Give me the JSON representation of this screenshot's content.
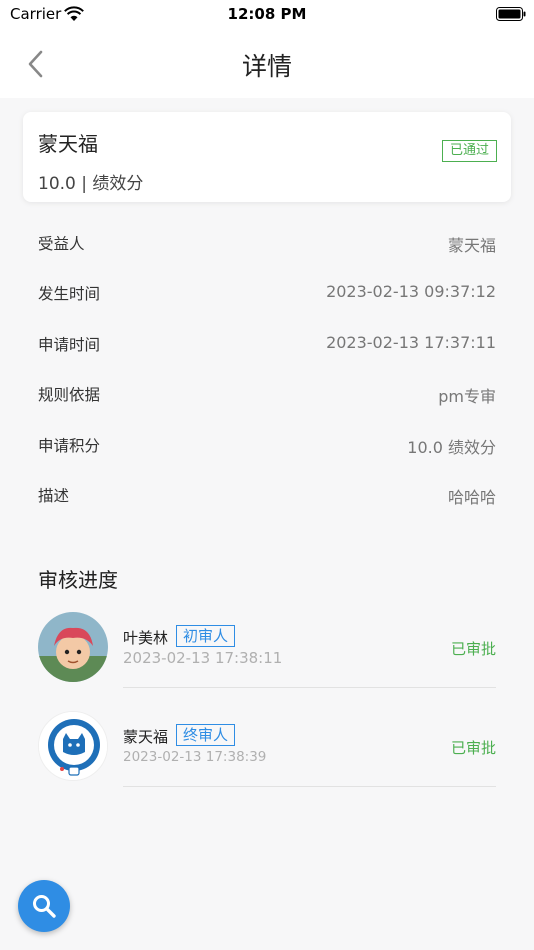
{
  "status_bar": {
    "carrier": "Carrier",
    "time": "12:08 PM"
  },
  "nav": {
    "title": "详情"
  },
  "summary": {
    "name": "蒙天福",
    "score": "10.0 | 绩效分",
    "status": "已通过"
  },
  "details": [
    {
      "label": "受益人",
      "value": "蒙天福"
    },
    {
      "label": "发生时间",
      "value": "2023-02-13 09:37:12"
    },
    {
      "label": "申请时间",
      "value": "2023-02-13 17:37:11"
    },
    {
      "label": "规则依据",
      "value": "pm专审"
    },
    {
      "label": "申请积分",
      "value": "10.0 绩效分"
    },
    {
      "label": "描述",
      "value": "哈哈哈"
    }
  ],
  "review": {
    "title": "审核进度",
    "approvers": [
      {
        "name": "叶美林",
        "role": "初审人",
        "time": "2023-02-13 17:38:11",
        "status": "已审批"
      },
      {
        "name": "蒙天福",
        "role": "终审人",
        "time": "2023-02-13 17:38:39",
        "status": "已审批"
      }
    ]
  },
  "colors": {
    "accent": "#2f8de4",
    "approved": "#4caf50"
  }
}
